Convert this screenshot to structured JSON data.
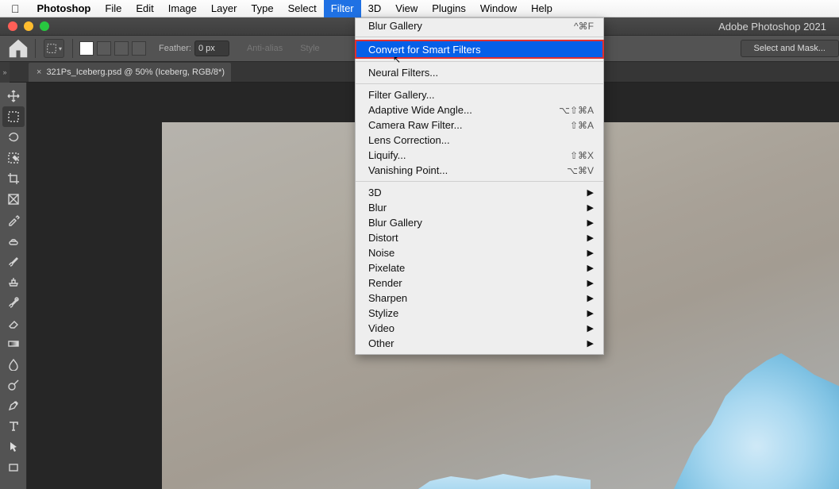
{
  "menubar": {
    "apple": "",
    "items": [
      "Photoshop",
      "File",
      "Edit",
      "Image",
      "Layer",
      "Type",
      "Select",
      "Filter",
      "3D",
      "View",
      "Plugins",
      "Window",
      "Help"
    ],
    "open_index": 7
  },
  "window": {
    "title": "",
    "title_right": "Adobe Photoshop 2021"
  },
  "options": {
    "feather_label": "Feather:",
    "feather_value": "0 px",
    "anti_alias": "Anti-alias",
    "style_label": "Style",
    "select_mask": "Select and Mask..."
  },
  "doc_tab": {
    "label": "321Ps_Iceberg.psd @ 50% (Iceberg, RGB/8*)"
  },
  "tools": [
    {
      "name": "move-tool"
    },
    {
      "name": "rectangular-marquee-tool",
      "active": true
    },
    {
      "name": "lasso-tool"
    },
    {
      "name": "object-selection-tool"
    },
    {
      "name": "crop-tool"
    },
    {
      "name": "frame-tool"
    },
    {
      "name": "eyedropper-tool"
    },
    {
      "name": "spot-healing-brush-tool"
    },
    {
      "name": "brush-tool"
    },
    {
      "name": "clone-stamp-tool"
    },
    {
      "name": "history-brush-tool"
    },
    {
      "name": "eraser-tool"
    },
    {
      "name": "gradient-tool"
    },
    {
      "name": "blur-tool"
    },
    {
      "name": "dodge-tool"
    },
    {
      "name": "pen-tool"
    },
    {
      "name": "type-tool"
    },
    {
      "name": "path-selection-tool"
    },
    {
      "name": "rectangle-tool"
    }
  ],
  "filter_menu": {
    "top": {
      "label": "Blur Gallery",
      "shortcut": "^⌘F"
    },
    "highlight": {
      "label": "Convert for Smart Filters"
    },
    "second": [
      {
        "label": "Neural Filters..."
      }
    ],
    "third": [
      {
        "label": "Filter Gallery..."
      },
      {
        "label": "Adaptive Wide Angle...",
        "shortcut": "⌥⇧⌘A"
      },
      {
        "label": "Camera Raw Filter...",
        "shortcut": "⇧⌘A"
      },
      {
        "label": "Lens Correction..."
      },
      {
        "label": "Liquify...",
        "shortcut": "⇧⌘X"
      },
      {
        "label": "Vanishing Point...",
        "shortcut": "⌥⌘V"
      }
    ],
    "subs": [
      {
        "label": "3D"
      },
      {
        "label": "Blur"
      },
      {
        "label": "Blur Gallery"
      },
      {
        "label": "Distort"
      },
      {
        "label": "Noise"
      },
      {
        "label": "Pixelate"
      },
      {
        "label": "Render"
      },
      {
        "label": "Sharpen"
      },
      {
        "label": "Stylize"
      },
      {
        "label": "Video"
      },
      {
        "label": "Other"
      }
    ]
  }
}
